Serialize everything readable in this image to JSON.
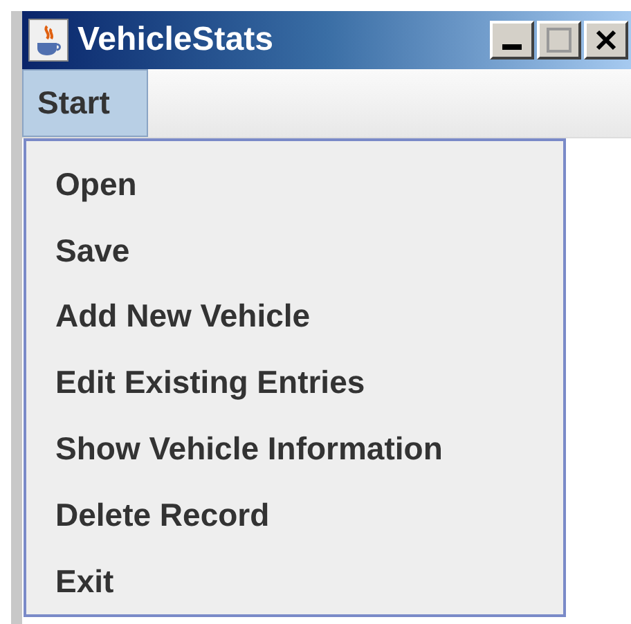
{
  "window": {
    "title": "VehicleStats"
  },
  "menu_bar": [
    {
      "label": "Start",
      "selected": true
    }
  ],
  "menu_items": [
    {
      "label": "Open"
    },
    {
      "label": "Save"
    },
    {
      "label": "Add New Vehicle"
    },
    {
      "label": "Edit Existing Entries"
    },
    {
      "label": "Show Vehicle Information"
    },
    {
      "label": "Delete Record"
    },
    {
      "label": "Exit"
    }
  ]
}
